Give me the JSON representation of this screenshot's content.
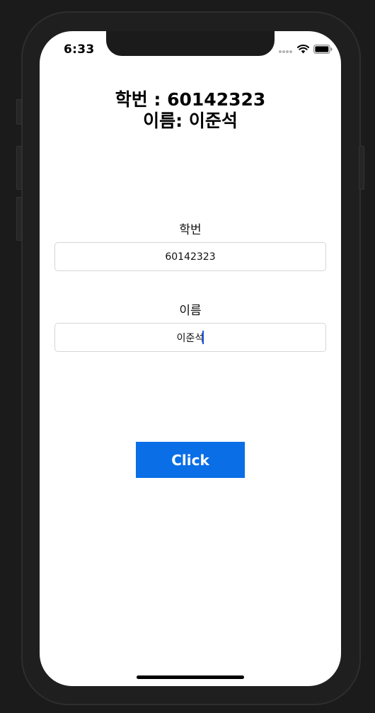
{
  "status_bar": {
    "time": "6:33",
    "icons": [
      "signal-dots-icon",
      "wifi-icon",
      "battery-icon"
    ]
  },
  "header": {
    "student_id_line": "학번 : 60142323",
    "name_line": "이름: 이준석"
  },
  "form": {
    "student_id": {
      "label": "학번",
      "value": "60142323"
    },
    "name": {
      "label": "이름",
      "value": "이준석"
    }
  },
  "button": {
    "label": "Click"
  },
  "colors": {
    "button_background": "#0a6ee6",
    "button_text": "#ffffff",
    "caret": "#1a56e8",
    "device_background": "#1b1b1b",
    "screen_background": "#ffffff"
  }
}
